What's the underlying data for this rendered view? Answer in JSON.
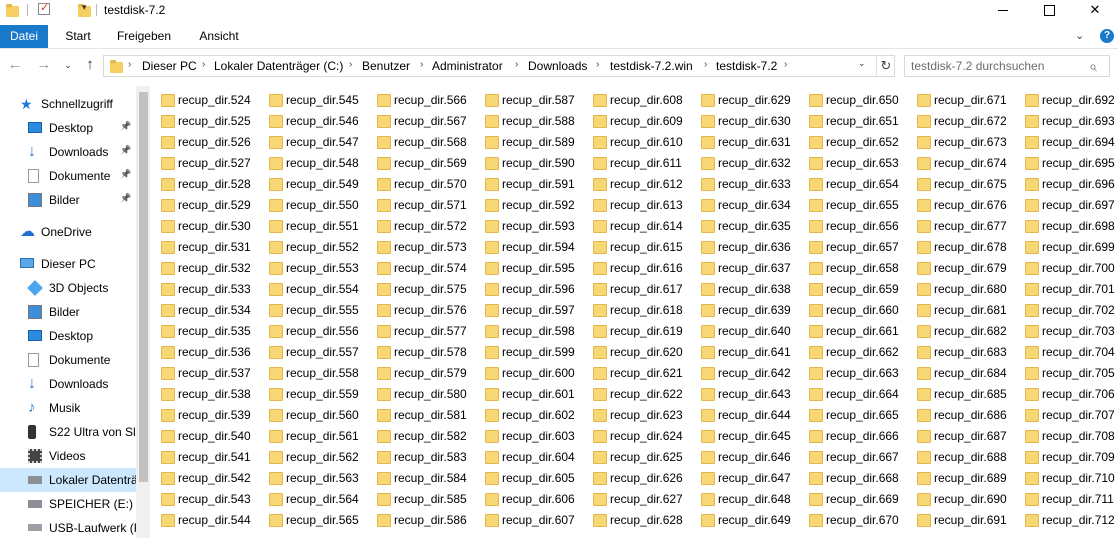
{
  "window": {
    "title": "testdisk-7.2",
    "minimize_label": "",
    "maximize_label": "",
    "close_label": "✕"
  },
  "ribbon": {
    "tabs": [
      "Datei",
      "Start",
      "Freigeben",
      "Ansicht"
    ],
    "active_tab": "Datei",
    "accent": "#1979ca"
  },
  "address": {
    "crumbs": [
      "Dieser PC",
      "Lokaler Datenträger (C:)",
      "Benutzer",
      "Administrator",
      "Downloads",
      "testdisk-7.2.win",
      "testdisk-7.2"
    ],
    "separator": "›"
  },
  "search": {
    "placeholder": "testdisk-7.2 durchsuchen"
  },
  "sidebar": {
    "items": [
      {
        "label": "Schnellzugriff",
        "icon": "star-icon",
        "indent": 0,
        "pinned": false
      },
      {
        "label": "Desktop",
        "icon": "desktop-icon",
        "indent": 1,
        "pinned": true
      },
      {
        "label": "Downloads",
        "icon": "download-arrow-icon",
        "indent": 1,
        "pinned": true
      },
      {
        "label": "Dokumente",
        "icon": "document-icon",
        "indent": 1,
        "pinned": true
      },
      {
        "label": "Bilder",
        "icon": "pictures-icon",
        "indent": 1,
        "pinned": true
      },
      {
        "label": "OneDrive",
        "icon": "cloud-icon",
        "indent": 0,
        "pinned": false
      },
      {
        "label": "Dieser PC",
        "icon": "computer-icon",
        "indent": 0,
        "pinned": false
      },
      {
        "label": "3D Objects",
        "icon": "cube-icon",
        "indent": 1,
        "pinned": false
      },
      {
        "label": "Bilder",
        "icon": "pictures-icon",
        "indent": 1,
        "pinned": false
      },
      {
        "label": "Desktop",
        "icon": "desktop-icon",
        "indent": 1,
        "pinned": false
      },
      {
        "label": "Dokumente",
        "icon": "document-icon",
        "indent": 1,
        "pinned": false
      },
      {
        "label": "Downloads",
        "icon": "download-arrow-icon",
        "indent": 1,
        "pinned": false
      },
      {
        "label": "Musik",
        "icon": "music-note-icon",
        "indent": 1,
        "pinned": false
      },
      {
        "label": "S22 Ultra von Sla",
        "icon": "phone-icon",
        "indent": 1,
        "pinned": false
      },
      {
        "label": "Videos",
        "icon": "video-icon",
        "indent": 1,
        "pinned": false
      },
      {
        "label": "Lokaler Datenträ",
        "icon": "drive-icon",
        "indent": 1,
        "pinned": false,
        "selected": true
      },
      {
        "label": "SPEICHER (E:)",
        "icon": "drive-icon",
        "indent": 1,
        "pinned": false
      },
      {
        "label": "USB-Laufwerk (F",
        "icon": "usb-drive-icon",
        "indent": 1,
        "pinned": false
      }
    ]
  },
  "files": {
    "prefix": "recup_dir.",
    "first": 524,
    "last": 712,
    "rows_per_column": 21
  }
}
